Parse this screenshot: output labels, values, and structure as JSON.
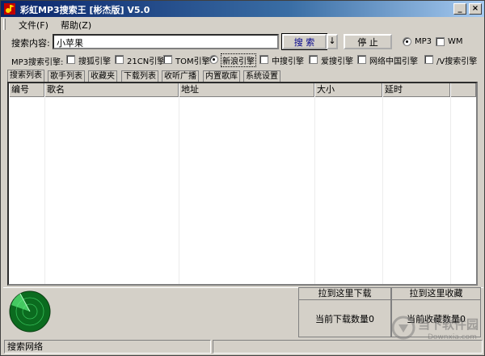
{
  "window": {
    "title": "彩虹MP3搜索王 [彬杰版] V5.0",
    "controls": {
      "minimize": "_",
      "close": "×"
    }
  },
  "menu": [
    {
      "label": "文件(F)"
    },
    {
      "label": "帮助(Z)"
    }
  ],
  "search": {
    "label": "搜索内容:",
    "value": "小苹果",
    "search_button": "搜 索",
    "dropdown_button": "↓",
    "stop_button": "停 止",
    "format_options": [
      {
        "label": "MP3",
        "selected": true
      },
      {
        "label": "WM",
        "selected": false
      }
    ]
  },
  "engines": {
    "label": "MP3搜索引擎:",
    "items": [
      {
        "label": "搜狐引擎",
        "kind": "check",
        "checked": false
      },
      {
        "label": "21CN引擎",
        "kind": "check",
        "checked": false
      },
      {
        "label": "TOM引擎",
        "kind": "check",
        "checked": false
      },
      {
        "label": "新浪引擎",
        "kind": "radio",
        "checked": true
      },
      {
        "label": "中搜引擎",
        "kind": "check",
        "checked": false
      },
      {
        "label": "爱搜引擎",
        "kind": "check",
        "checked": false
      },
      {
        "label": "网络中国引擎",
        "kind": "check",
        "checked": false
      },
      {
        "label": "/V搜索引擎",
        "kind": "check",
        "checked": false
      }
    ]
  },
  "tabs": [
    {
      "label": "搜索列表",
      "active": true
    },
    {
      "label": "歌手列表",
      "active": false
    },
    {
      "label": "收藏夹",
      "active": false
    },
    {
      "label": "下载列表",
      "active": false
    },
    {
      "label": "收听广播",
      "active": false
    },
    {
      "label": "内置歌库",
      "active": false
    },
    {
      "label": "系统设置",
      "active": false
    }
  ],
  "list": {
    "columns": [
      "编号",
      "歌名",
      "地址",
      "大小",
      "延时",
      ""
    ],
    "rows": []
  },
  "download_panel": {
    "title": "拉到这里下载",
    "count_text": "当前下载数量0"
  },
  "favorite_panel": {
    "title": "拉到这里收藏",
    "count_text": "当前收藏数量0"
  },
  "status": {
    "text": "搜索网络"
  },
  "watermark": {
    "brand": "当下软件园",
    "domain": "Downxia.com"
  },
  "colors": {
    "title_gradient_start": "#0a246a",
    "title_gradient_end": "#a6caf0",
    "face": "#d4d0c8",
    "radar_green": "#0f8a2a"
  },
  "icons": [
    "app-icon",
    "radar-icon",
    "watermark-logo"
  ]
}
